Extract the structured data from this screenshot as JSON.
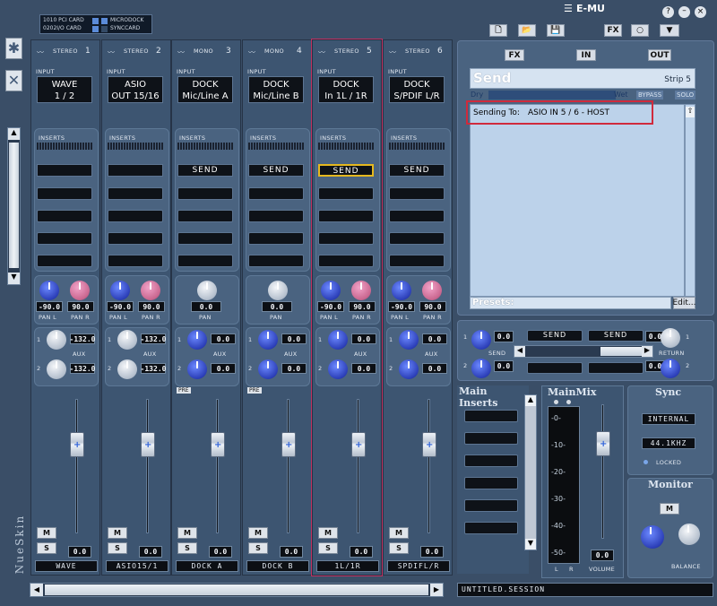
{
  "app": {
    "brand": "E-MU",
    "skin_label": "NueSkin"
  },
  "legend": {
    "pci_card": "1010 PCI CARD",
    "io_card": "0202I/O CARD",
    "microdock": "MICRODOCK",
    "synccard": "SYNCCARD"
  },
  "strips": [
    {
      "number": "1",
      "type": "STEREO",
      "input_line1": "WAVE",
      "input_line2": "1 / 2",
      "insert_btn": "",
      "pan_l": "-90.0",
      "pan_r": "90.0",
      "pan_single": "",
      "aux1": "-132.0",
      "aux2": "-132.0",
      "pre": "",
      "fader_val": "0.0",
      "name": "WAVE"
    },
    {
      "number": "2",
      "type": "STEREO",
      "input_line1": "ASIO",
      "input_line2": "OUT 15/16",
      "insert_btn": "",
      "pan_l": "-90.0",
      "pan_r": "90.0",
      "pan_single": "",
      "aux1": "-132.0",
      "aux2": "-132.0",
      "pre": "",
      "fader_val": "0.0",
      "name": "ASIO15/1"
    },
    {
      "number": "3",
      "type": "MONO",
      "input_line1": "DOCK",
      "input_line2": "Mic/Line A",
      "insert_btn": "SEND",
      "pan_l": "",
      "pan_r": "",
      "pan_single": "0.0",
      "aux1": "0.0",
      "aux2": "0.0",
      "pre": "PRE",
      "fader_val": "0.0",
      "name": "DOCK A"
    },
    {
      "number": "4",
      "type": "MONO",
      "input_line1": "DOCK",
      "input_line2": "Mic/Line B",
      "insert_btn": "SEND",
      "pan_l": "",
      "pan_r": "",
      "pan_single": "0.0",
      "aux1": "0.0",
      "aux2": "0.0",
      "pre": "PRE",
      "fader_val": "0.0",
      "name": "DOCK B"
    },
    {
      "number": "5",
      "type": "STEREO",
      "input_line1": "DOCK",
      "input_line2": "In 1L / 1R",
      "insert_btn": "SEND",
      "pan_l": "-90.0",
      "pan_r": "90.0",
      "pan_single": "",
      "aux1": "0.0",
      "aux2": "0.0",
      "pre": "",
      "fader_val": "0.0",
      "name": "1L/1R"
    },
    {
      "number": "6",
      "type": "STEREO",
      "input_line1": "DOCK",
      "input_line2": "S/PDIF L/R",
      "insert_btn": "SEND",
      "pan_l": "-90.0",
      "pan_r": "90.0",
      "pan_single": "",
      "aux1": "0.0",
      "aux2": "0.0",
      "pre": "",
      "fader_val": "0.0",
      "name": "SPDIFL/R"
    }
  ],
  "labels": {
    "input": "INPUT",
    "inserts": "INSERTS",
    "pan": "PAN",
    "pan_l": "PAN L",
    "pan_r": "PAN R",
    "aux": "AUX",
    "aux1_num": "1",
    "aux2_num": "2",
    "mute": "M",
    "solo": "S"
  },
  "right_panel": {
    "tabs": {
      "fx": "FX",
      "in": "IN",
      "out": "OUT"
    },
    "send_title": "Send",
    "strip_label": "Strip 5",
    "dry": "Dry",
    "wet": "Wet",
    "bypass": "BYPASS",
    "solo": "SOLO",
    "sending_to_label": "Sending To:",
    "sending_to_value": "ASIO IN 5 / 6 - HOST",
    "presets": "Presets:",
    "edit": "Edit..."
  },
  "sends_area": {
    "aux1_num": "1",
    "aux2_num": "2",
    "send_val1": "0.0",
    "send_val2": "0.0",
    "send_label": "SEND",
    "send_btn1": "SEND",
    "send_btn2": "SEND",
    "return_val1": "0.0",
    "return_val2": "0.0",
    "return_label": "RETURN"
  },
  "main": {
    "inserts_title": "Main Inserts",
    "mix_title": "MainMix",
    "meter_ticks": [
      "-0-",
      "-10-",
      "-20-",
      "-30-",
      "-40-",
      "-50-"
    ],
    "meter_l": "L",
    "meter_r": "R",
    "volume_val": "0.0",
    "volume_label": "VOLUME",
    "sync_title": "Sync",
    "sync_source": "INTERNAL",
    "sample_rate": "44.1KHZ",
    "locked": "LOCKED",
    "monitor_title": "Monitor",
    "monitor_m": "M",
    "balance_label": "BALANCE",
    "session": "UNTITLED.SESSION"
  }
}
